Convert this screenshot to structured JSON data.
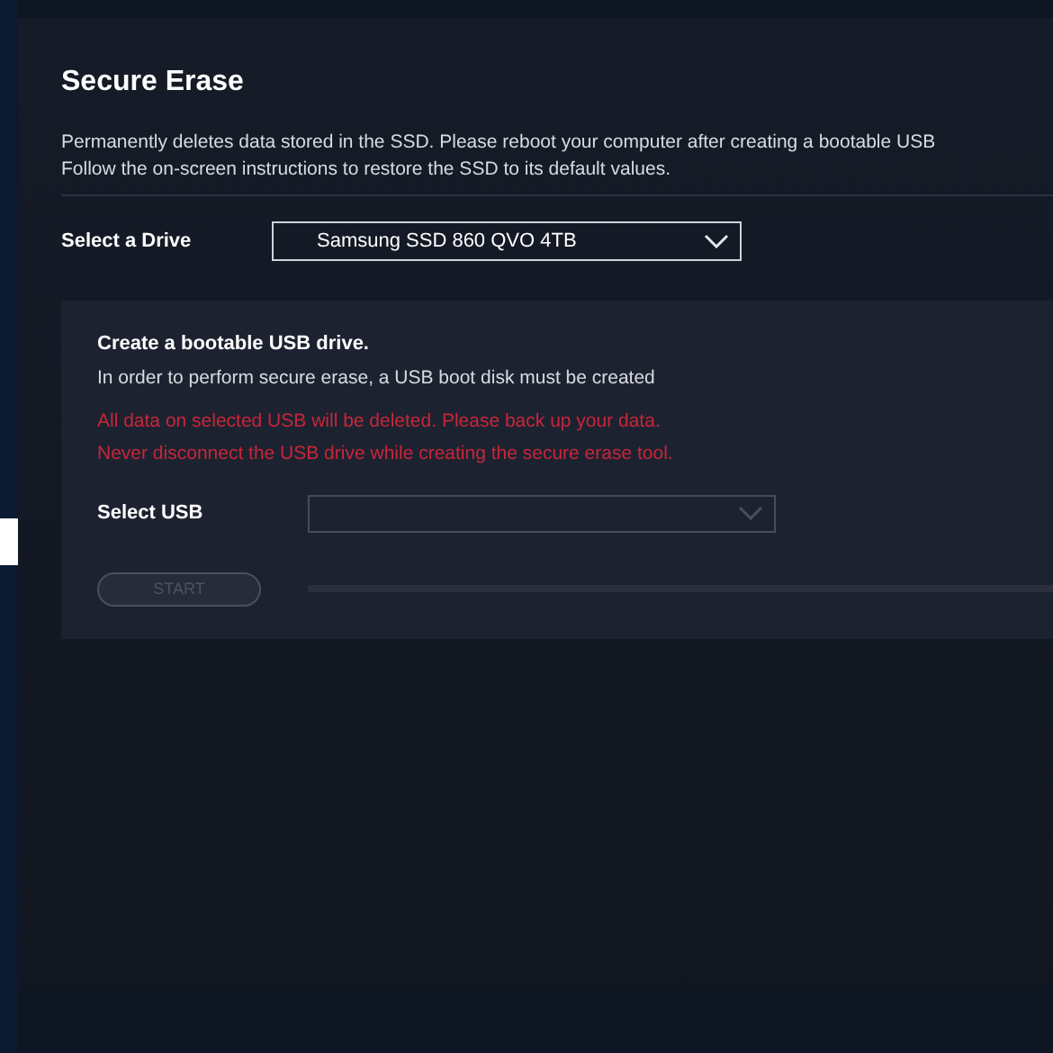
{
  "title": "Secure Erase",
  "description": [
    "Permanently deletes data stored in the SSD. Please reboot your computer after creating a bootable USB",
    "Follow the on-screen instructions to restore the SSD to its default values."
  ],
  "drive": {
    "label": "Select a Drive",
    "value": "Samsung SSD 860 QVO 4TB"
  },
  "usb_card": {
    "heading": "Create a bootable USB drive.",
    "subtitle": "In order to perform secure erase, a USB boot disk must be created",
    "warnings": [
      "All data on selected USB will be deleted. Please back up your data.",
      "Never disconnect the USB drive while creating the secure erase tool."
    ],
    "usb_label": "Select USB",
    "usb_disabled": true,
    "start_button": {
      "label": "START",
      "disabled": true
    },
    "progress": {
      "level": 0
    }
  }
}
